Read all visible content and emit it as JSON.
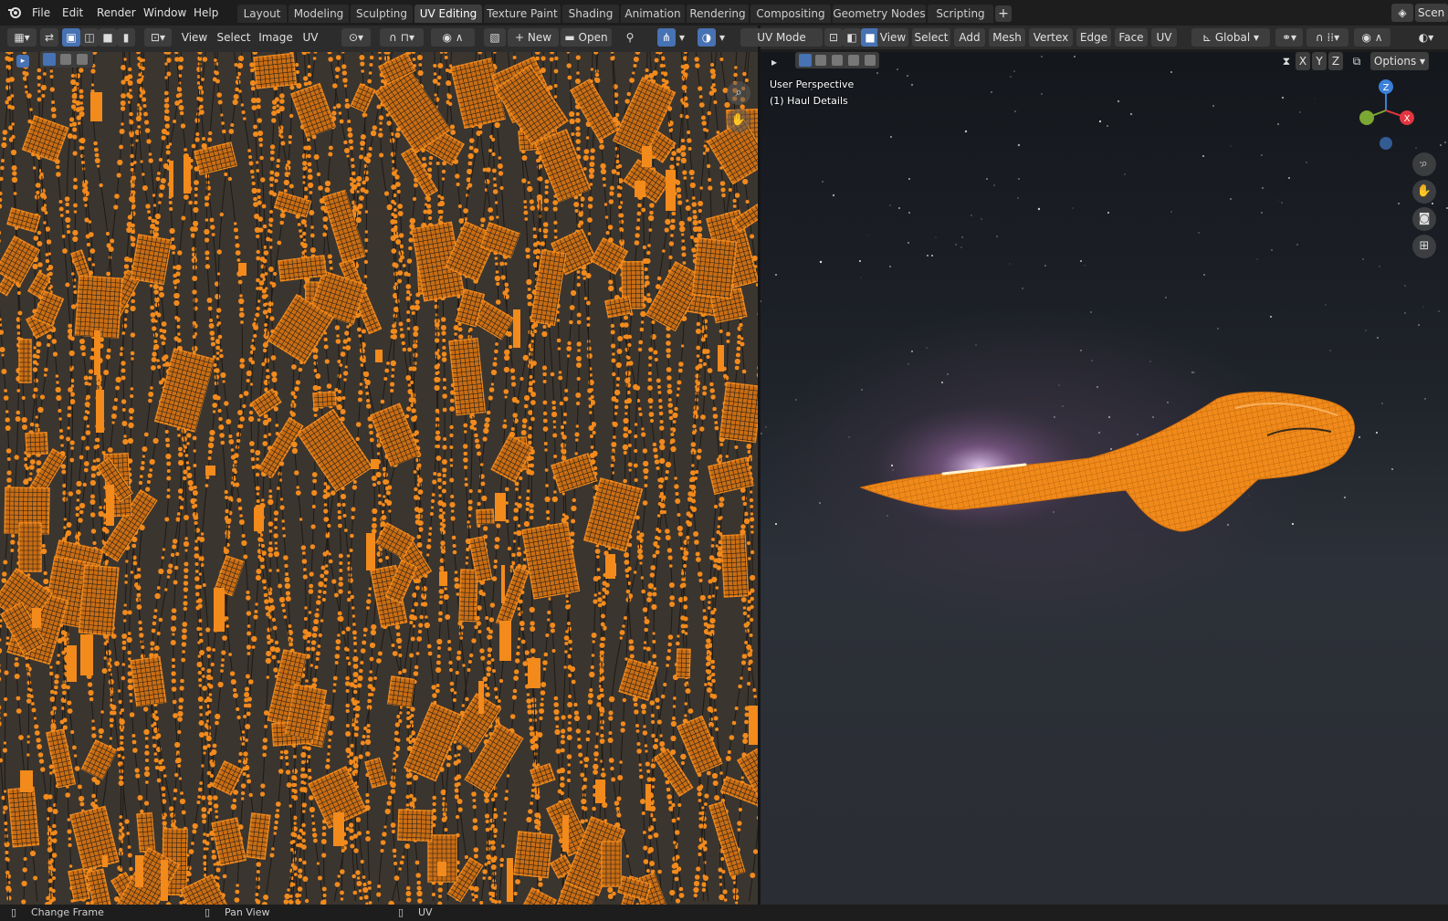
{
  "menubar": {
    "items": [
      "File",
      "Edit",
      "Render",
      "Window",
      "Help"
    ],
    "workspace_tabs": [
      "Layout",
      "Modeling",
      "Sculpting",
      "UV Editing",
      "Texture Paint",
      "Shading",
      "Animation",
      "Rendering",
      "Compositing",
      "Geometry Nodes",
      "Scripting"
    ],
    "active_tab": "UV Editing",
    "scene_label": "Scen"
  },
  "uv_header": {
    "menus": [
      "View",
      "Select",
      "Image",
      "UV"
    ],
    "new_label": "New",
    "open_label": "Open"
  },
  "viewport_header": {
    "mode_label": "UV Mode",
    "menus": [
      "View",
      "Select",
      "Add",
      "Mesh",
      "Vertex",
      "Edge",
      "Face",
      "UV"
    ],
    "transform_orientation": "Global",
    "axes": [
      "X",
      "Y",
      "Z"
    ],
    "options_label": "Options"
  },
  "viewport": {
    "perspective": "User Perspective",
    "object": "(1) Haul Details",
    "gizmo": {
      "z": "Z",
      "x": "X"
    }
  },
  "statusbar": {
    "items": [
      "Change Frame",
      "Pan View",
      "UV"
    ]
  },
  "colors": {
    "uv_orange": "#f28a1c",
    "uv_background": "#3b352f",
    "active_tab": "#3d3d3d",
    "selection_blue": "#4772b3",
    "gizmo_z": "#3b7fd8",
    "gizmo_x": "#e2353f",
    "gizmo_y": "#7ba832"
  },
  "icons": [
    "blender-logo-icon",
    "editor-type-icon",
    "sync-selection-icon",
    "select-mode-icon",
    "pin-icon",
    "snap-icon",
    "zoom-icon",
    "hand-icon",
    "camera-icon",
    "grid-icon"
  ]
}
